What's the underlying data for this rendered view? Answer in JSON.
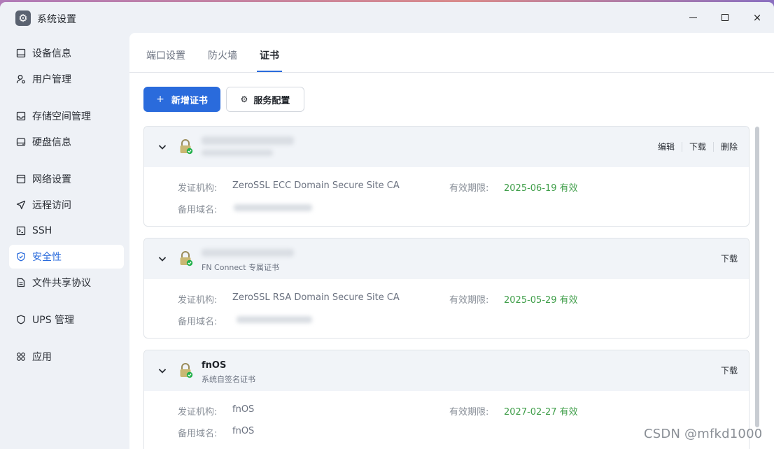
{
  "app": {
    "title": "系统设置",
    "icon": "gear-icon"
  },
  "window_controls": {
    "minimize": "minimize-icon",
    "maximize": "maximize-icon",
    "close": "×"
  },
  "sidebar": {
    "items": [
      {
        "label": "设备信息",
        "icon": "monitor-icon"
      },
      {
        "label": "用户管理",
        "icon": "user-icon"
      },
      {
        "label": "存储空间管理",
        "icon": "storage-icon"
      },
      {
        "label": "硬盘信息",
        "icon": "disk-icon"
      },
      {
        "label": "网络设置",
        "icon": "network-icon"
      },
      {
        "label": "远程访问",
        "icon": "send-icon"
      },
      {
        "label": "SSH",
        "icon": "terminal-icon"
      },
      {
        "label": "安全性",
        "icon": "shield-icon",
        "active": true
      },
      {
        "label": "文件共享协议",
        "icon": "file-icon"
      },
      {
        "label": "UPS 管理",
        "icon": "ups-icon"
      },
      {
        "label": "应用",
        "icon": "apps-icon"
      }
    ]
  },
  "tabs": [
    {
      "label": "端口设置"
    },
    {
      "label": "防火墙"
    },
    {
      "label": "证书",
      "active": true
    }
  ],
  "toolbar": {
    "add_label": "新增证书",
    "config_label": "服务配置"
  },
  "labels": {
    "issuer": "发证机构:",
    "expiry": "有效期限:",
    "alt_domain": "备用域名:"
  },
  "certificates": [
    {
      "name": "",
      "subtitle": "",
      "actions": [
        "编辑",
        "下载",
        "删除"
      ],
      "issuer": "ZeroSSL ECC Domain Secure Site CA",
      "expiry": "2025-06-19 有效",
      "alt_domain": ""
    },
    {
      "name": "",
      "subtitle": "FN Connect 专属证书",
      "actions": [
        "下载"
      ],
      "issuer": "ZeroSSL RSA Domain Secure Site CA",
      "expiry": "2025-05-29 有效",
      "alt_domain": ""
    },
    {
      "name": "fnOS",
      "subtitle": "系统自签名证书",
      "actions": [
        "下载"
      ],
      "issuer": "fnOS",
      "expiry": "2027-02-27 有效",
      "alt_domain": "fnOS"
    }
  ],
  "watermark": "CSDN @mfkd1000",
  "colors": {
    "accent": "#2a6bdc",
    "valid": "#3f9e49",
    "lock_check": "#22b04b"
  }
}
